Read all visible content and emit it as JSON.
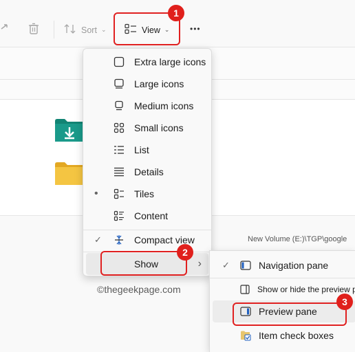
{
  "toolbar": {
    "sort_label": "Sort",
    "view_label": "View",
    "more_label": "•••"
  },
  "view_menu": {
    "items": [
      {
        "label": "Extra large icons",
        "icon": "extra-large-icons-icon"
      },
      {
        "label": "Large icons",
        "icon": "large-icons-icon"
      },
      {
        "label": "Medium icons",
        "icon": "medium-icons-icon"
      },
      {
        "label": "Small icons",
        "icon": "small-icons-icon"
      },
      {
        "label": "List",
        "icon": "list-icon"
      },
      {
        "label": "Details",
        "icon": "details-icon"
      },
      {
        "label": "Tiles",
        "icon": "tiles-icon",
        "selected_mark": "•"
      },
      {
        "label": "Content",
        "icon": "content-icon"
      }
    ],
    "compact_view": {
      "label": "Compact view",
      "check": "✓"
    },
    "show": {
      "label": "Show",
      "arrow": "›"
    }
  },
  "show_submenu": {
    "items": [
      {
        "label": "Navigation pane",
        "check": "✓",
        "icon": "navigation-pane-icon"
      },
      {
        "label": "Show or hide the preview p",
        "icon": "tooltip-preview-icon"
      },
      {
        "label": "Preview pane",
        "icon": "preview-pane-icon"
      },
      {
        "label": "Item check boxes",
        "icon": "item-check-boxes-icon"
      }
    ]
  },
  "status": {
    "path": "New Volume (E:)\\TGP\\google"
  },
  "watermark": "©thegeekpage.com",
  "callouts": {
    "one": "1",
    "two": "2",
    "three": "3"
  },
  "colors": {
    "callout_red": "#e0201c",
    "folder_teal": "#1a9a8a",
    "folder_yellow": "#f4c542",
    "accent_blue": "#1f5fbf"
  }
}
